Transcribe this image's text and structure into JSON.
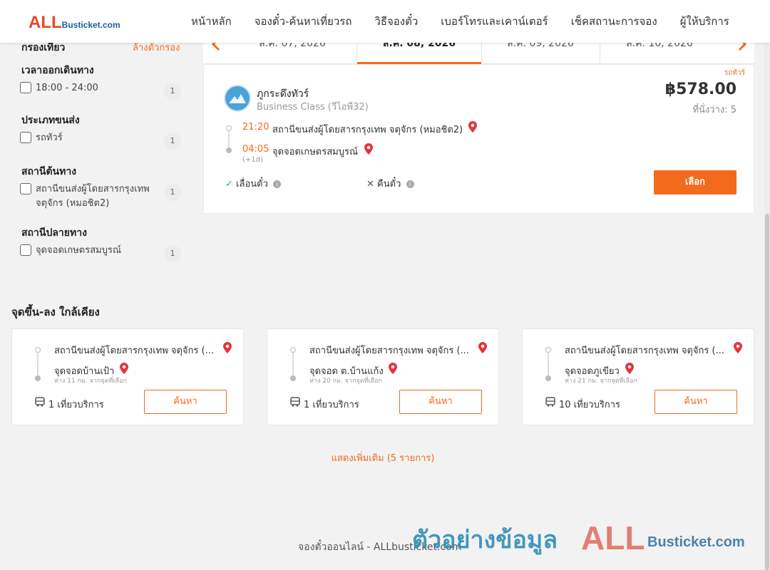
{
  "header": {
    "logo_big": "ALL",
    "logo_small": "Busticket.com",
    "nav": [
      "หน้าหลัก",
      "จองตั๋ว-ค้นหาเที่ยวรถ",
      "วิธีจองตั๋ว",
      "เบอร์โทรและเคาน์เตอร์",
      "เช็คสถานะการจอง",
      "ผู้ให้บริการ"
    ]
  },
  "sidebar": {
    "title": "กรองเที่ยว",
    "clear": "ล้างตัวกรอง",
    "groups": [
      {
        "heading": "เวลาออกเดินทาง",
        "items": [
          {
            "label": "18:00 - 24:00",
            "count": "1"
          }
        ]
      },
      {
        "heading": "ประเภทขนส่ง",
        "items": [
          {
            "label": "รถทัวร์",
            "count": "1"
          }
        ]
      },
      {
        "heading": "สถานีต้นทาง",
        "items": [
          {
            "label": "สถานีขนส่งผู้โดยสารกรุงเทพ จตุจักร (หมอชิต2)",
            "count": "1"
          }
        ]
      },
      {
        "heading": "สถานีปลายทาง",
        "items": [
          {
            "label": "จุดจอดเกษตรสมบูรณ์",
            "count": "1"
          }
        ]
      }
    ]
  },
  "dates": [
    "ส.ค. 07, 2026",
    "ส.ค. 08, 2026",
    "ส.ค. 09, 2026",
    "ส.ค. 10, 2026"
  ],
  "trip": {
    "tag": "รถทัวร์",
    "operator": "ภูกระดึงทัวร์",
    "bus_class": "Business Class (วีไอพี32)",
    "price": "฿578.00",
    "seats": "ที่นั่งว่าง: 5",
    "depart_time": "21:20",
    "depart_station": "สถานีขนส่งผู้โดยสารกรุงเทพ จตุจักร (หมอชิต2)",
    "arrive_time": "04:05",
    "arrive_station": "จุดจอดเกษตรสมบูรณ์",
    "day_offset": "(+1d)",
    "change_policy": "เลื่อนตั๋ว",
    "refund_policy": "คืนตั๋ว",
    "select_label": "เลือก"
  },
  "nearby": {
    "title": "จุดขึ้น-ลง ใกล้เคียง",
    "cards": [
      {
        "from": "สถานีขนส่งผู้โดยสารกรุงเทพ จตุจักร (...",
        "to": "จุดจอดบ้านเป้า",
        "distance": "ห่าง 11 กม. จากจุดที่เลือก",
        "trips": "1 เที่ยวบริการ",
        "button": "ค้นหา"
      },
      {
        "from": "สถานีขนส่งผู้โดยสารกรุงเทพ จตุจักร (...",
        "to": "จุดจอด ต.บ้านแก้ง",
        "distance": "ห่าง 20 กม. จากจุดที่เลือก",
        "trips": "1 เที่ยวบริการ",
        "button": "ค้นหา"
      },
      {
        "from": "สถานีขนส่งผู้โดยสารกรุงเทพ จตุจักร (...",
        "to": "จุดจอดภูเขียว",
        "distance": "ห่าง 21 กม. จากจุดที่เลือก",
        "trips": "10 เที่ยวบริการ",
        "button": "ค้นหา"
      }
    ],
    "show_more": "แสดงเพิ่มเติม (5 รายการ)"
  },
  "footer": {
    "text": "จองตั๋วออนไลน์ - ALLbusticket.com"
  },
  "watermark": {
    "thai": "ตัวอย่างข้อมูล",
    "big": "ALL",
    "small": "Busticket.com"
  },
  "colors": {
    "accent": "#f26b1d",
    "ok": "#2fa84f",
    "pin": "#e8323a",
    "logo_red": "#e8472c",
    "logo_blue": "#1b5f9e"
  },
  "icons": [
    "location-pin-icon",
    "check-icon",
    "cross-icon",
    "info-icon",
    "bus-icon",
    "chevron-left-icon",
    "chevron-right-icon"
  ]
}
